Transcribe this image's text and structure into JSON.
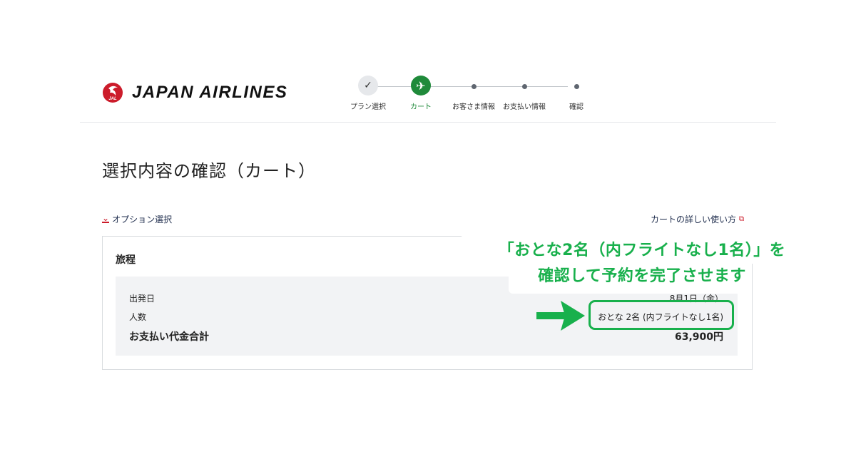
{
  "header": {
    "brand": "JAPAN AIRLINES",
    "logo_mark_text": "JAL",
    "steps": [
      {
        "label": "プラン選択",
        "state": "done"
      },
      {
        "label": "カート",
        "state": "current"
      },
      {
        "label": "お客さま情報",
        "state": "todo"
      },
      {
        "label": "お支払い情報",
        "state": "todo"
      },
      {
        "label": "確認",
        "state": "todo"
      }
    ]
  },
  "page": {
    "title": "選択内容の確認（カート）",
    "option_link": "オプション選択",
    "help_link": "カートの詳しい使い方"
  },
  "itinerary": {
    "title": "旅程",
    "rows": [
      {
        "label": "出発日",
        "value": "8月1日（金）"
      },
      {
        "label": "人数",
        "value": "おとな 2名 (内フライトなし1名)"
      },
      {
        "label": "お支払い代金合計",
        "value": "63,900円"
      }
    ]
  },
  "annotation": {
    "line1": "「おとな2名（内フライトなし1名）」を",
    "line2": "確認して予約を完了させます"
  },
  "colors": {
    "brand_red": "#cc1c2b",
    "step_green": "#1f8a3a",
    "annotation_green": "#18b04c"
  }
}
